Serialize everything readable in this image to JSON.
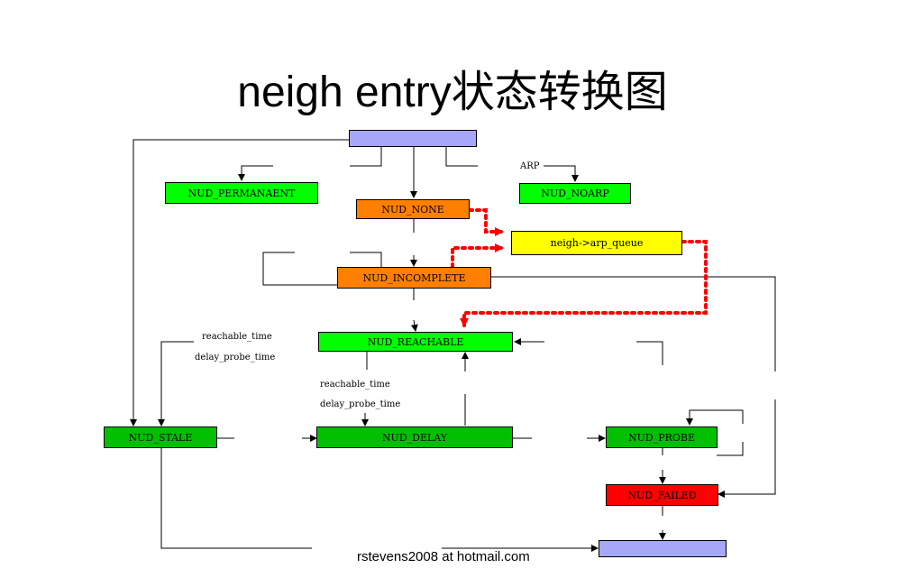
{
  "title": "neigh entry状态转换图",
  "footer": "rstevens2008 at hotmail.com",
  "colors": {
    "start_box": "#a7a7f7",
    "end_box": "#a7a7f7",
    "green_bright": "#00ff00",
    "green_dark": "#00c000",
    "orange": "#ff8000",
    "yellow": "#ffff00",
    "red": "#ff0000",
    "dotted_path": "#ff0000"
  },
  "states": {
    "permanent": "NUD_PERMANAENT",
    "none": "NUD_NONE",
    "noarp": "NUD_NOARP",
    "arp_queue": "neigh->arp_queue",
    "incomplete": "NUD_INCOMPLETE",
    "reachable": "NUD_REACHABLE",
    "stale": "NUD_STALE",
    "delay": "NUD_DELAY",
    "probe": "NUD_PROBE",
    "failed": "NUD_FAILED"
  },
  "labels": {
    "arp": "ARP",
    "reachable_time_left": "reachable_time",
    "delay_probe_time_left": "delay_probe_time",
    "reachable_time_mid": "reachable_time",
    "delay_probe_time_mid": "delay_probe_time"
  }
}
